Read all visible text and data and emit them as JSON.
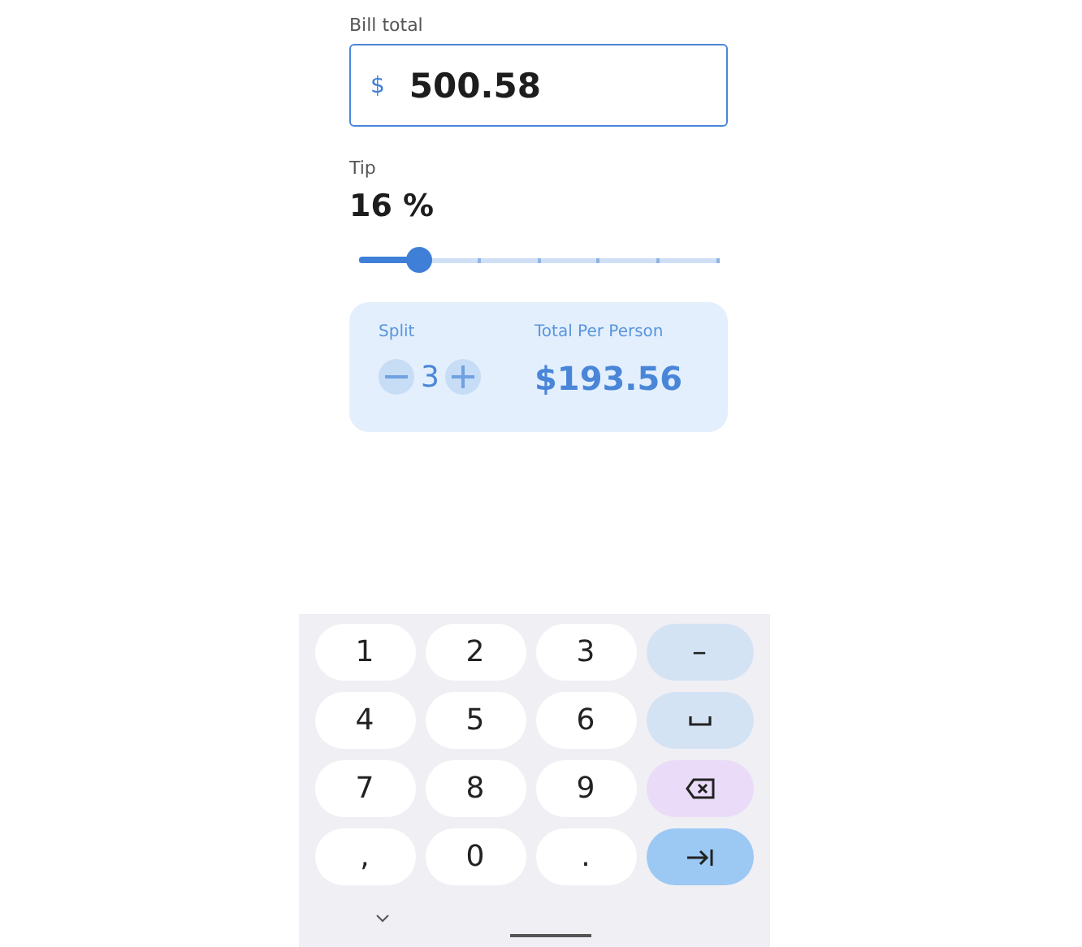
{
  "bill": {
    "label": "Bill total",
    "currency": "$",
    "value": "500.58"
  },
  "tip": {
    "label": "Tip",
    "value": "16 %",
    "level": 0.167
  },
  "split_card": {
    "split_label": "Split",
    "count": "3",
    "total_label": "Total Per Person",
    "total": "$193.56"
  },
  "keyboard": {
    "rows": [
      [
        {
          "kind": "digit",
          "label": "1"
        },
        {
          "kind": "digit",
          "label": "2"
        },
        {
          "kind": "digit",
          "label": "3"
        },
        {
          "kind": "symbol",
          "label": "–"
        }
      ],
      [
        {
          "kind": "digit",
          "label": "4"
        },
        {
          "kind": "digit",
          "label": "5"
        },
        {
          "kind": "digit",
          "label": "6"
        },
        {
          "kind": "space"
        }
      ],
      [
        {
          "kind": "digit",
          "label": "7"
        },
        {
          "kind": "digit",
          "label": "8"
        },
        {
          "kind": "digit",
          "label": "9"
        },
        {
          "kind": "backspace"
        }
      ],
      [
        {
          "kind": "digit",
          "label": ","
        },
        {
          "kind": "digit",
          "label": "0"
        },
        {
          "kind": "digit",
          "label": "."
        },
        {
          "kind": "tab"
        }
      ]
    ]
  }
}
